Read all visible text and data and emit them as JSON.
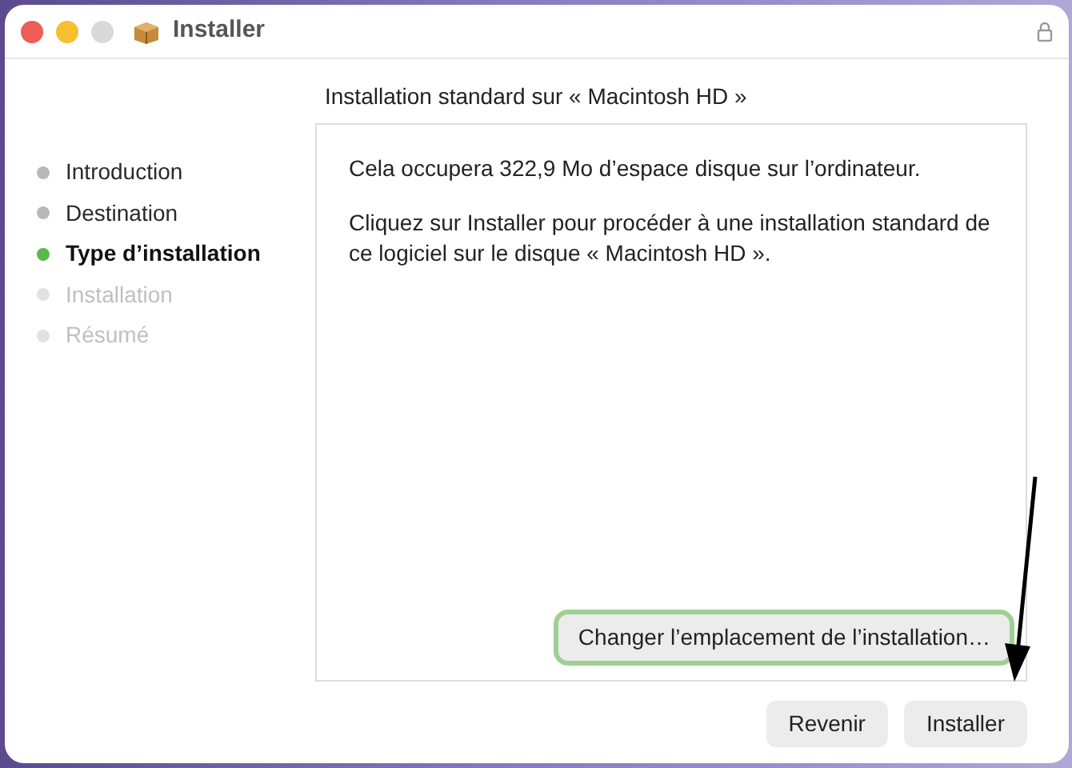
{
  "window": {
    "title": "Installer"
  },
  "steps": [
    {
      "label": "Introduction",
      "selected": false,
      "completed": true
    },
    {
      "label": "Destination",
      "selected": false,
      "completed": true
    },
    {
      "label": "Type d’installation",
      "selected": true,
      "completed": false
    },
    {
      "label": "Installation",
      "selected": false,
      "completed": false
    },
    {
      "label": "Résumé",
      "selected": false,
      "completed": false
    }
  ],
  "heading": "Installation standard sur « Macintosh HD »",
  "paragraphs": [
    "Cela occupera 322,9 Mo d’espace disque sur l’ordinateur.",
    "Cliquez sur Installer pour procéder à une installation standard de ce logiciel sur le disque « Macintosh HD »."
  ],
  "change_location_button": {
    "label": "Changer l’emplacement de l’installation…",
    "highlighted": true
  },
  "buttons": [
    "Revenir",
    "Installer"
  ]
}
